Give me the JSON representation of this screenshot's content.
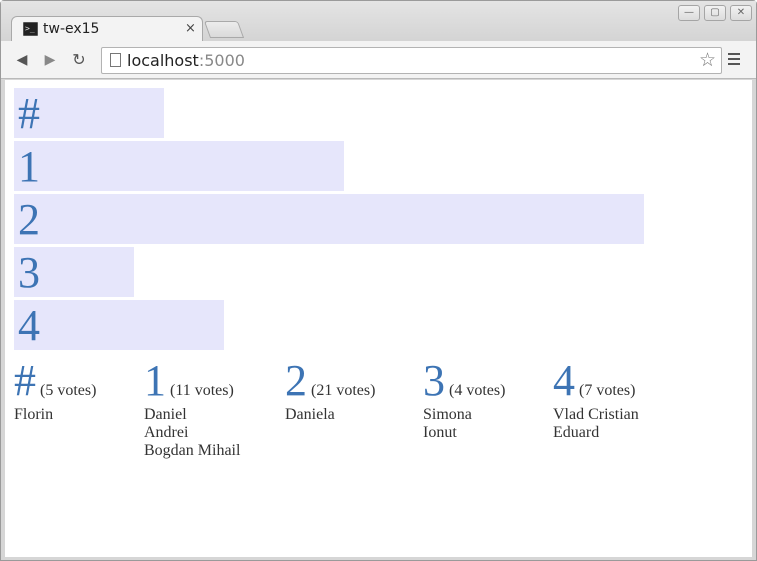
{
  "browser": {
    "tab_title": "tw-ex15",
    "tab_close": "×",
    "favicon_glyph": ">_",
    "url_host": "localhost",
    "url_port": ":5000",
    "bookmark_glyph": "☆",
    "back_glyph": "◀",
    "forward_glyph": "▶",
    "reload_glyph": "↻",
    "minimize_glyph": "—",
    "maximize_glyph": "▢",
    "close_glyph": "✕"
  },
  "chart_data": {
    "type": "bar",
    "orientation": "horizontal",
    "categories": [
      "#",
      "1",
      "2",
      "3",
      "4"
    ],
    "values": [
      5,
      11,
      21,
      4,
      7
    ],
    "bar_color": "#e6e6fb",
    "label_color": "#3d74b4"
  },
  "results": [
    {
      "option": "#",
      "votes": "(5 votes)",
      "names": [
        "Florin"
      ]
    },
    {
      "option": "1",
      "votes": "(11 votes)",
      "names": [
        "Daniel",
        "Andrei",
        "Bogdan Mihail"
      ]
    },
    {
      "option": "2",
      "votes": "(21 votes)",
      "names": [
        "Daniela"
      ]
    },
    {
      "option": "3",
      "votes": "(4 votes)",
      "names": [
        "Simona",
        "Ionut"
      ]
    },
    {
      "option": "4",
      "votes": "(7 votes)",
      "names": [
        "Vlad Cristian",
        "Eduard"
      ]
    }
  ]
}
